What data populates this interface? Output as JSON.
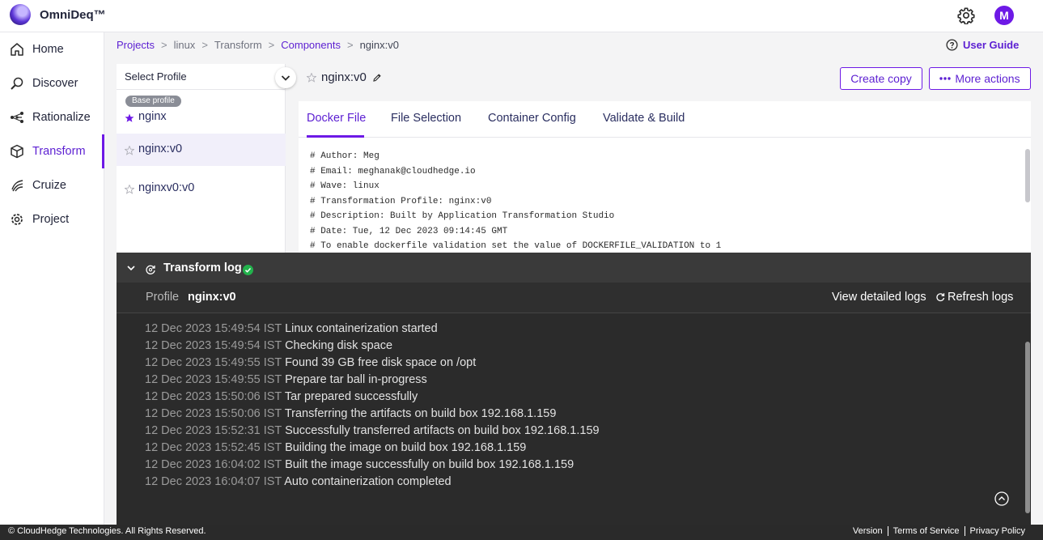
{
  "app": {
    "brand": "OmniDeq™",
    "avatar_initial": "M"
  },
  "sidebar": {
    "items": [
      {
        "label": "Home",
        "icon": "home-icon"
      },
      {
        "label": "Discover",
        "icon": "discover-icon"
      },
      {
        "label": "Rationalize",
        "icon": "rationalize-icon"
      },
      {
        "label": "Transform",
        "icon": "transform-icon",
        "active": true
      },
      {
        "label": "Cruize",
        "icon": "cruize-icon"
      },
      {
        "label": "Project",
        "icon": "project-gear-icon"
      }
    ]
  },
  "breadcrumb": {
    "projects": "Projects",
    "linux": "linux",
    "transform": "Transform",
    "components": "Components",
    "current": "nginx:v0",
    "separator": ">"
  },
  "user_guide": "User Guide",
  "profiles": {
    "select_placeholder": "Select Profile",
    "base_badge": "Base profile",
    "items": [
      {
        "name": "nginx",
        "starred": true
      },
      {
        "name": "nginx:v0",
        "starred": false,
        "selected": true
      },
      {
        "name": "nginxv0:v0",
        "starred": false
      }
    ]
  },
  "component": {
    "title": "nginx:v0",
    "create_copy": "Create copy",
    "more_actions": "More actions"
  },
  "tabs": [
    "Docker File",
    "File Selection",
    "Container Config",
    "Validate & Build"
  ],
  "dockerfile_lines": [
    "# Author: Meg",
    "# Email: meghanak@cloudhedge.io",
    "# Wave: linux",
    "# Transformation Profile: nginx:v0",
    "# Description: Built by Application Transformation Studio",
    "# Date: Tue, 12 Dec 2023 09:14:45 GMT",
    "# To enable dockerfile validation set the value of DOCKERFILE_VALIDATION to 1"
  ],
  "transform_log": {
    "title": "Transform log",
    "profile_label": "Profile",
    "profile_value": "nginx:v0",
    "view_detailed": "View detailed logs",
    "refresh": "Refresh logs",
    "lines": [
      {
        "ts": "12 Dec 2023 15:49:54 IST",
        "msg": "Linux containerization started"
      },
      {
        "ts": "12 Dec 2023 15:49:54 IST",
        "msg": "Checking disk space"
      },
      {
        "ts": "12 Dec 2023 15:49:55 IST",
        "msg": "Found 39 GB free disk space on /opt"
      },
      {
        "ts": "12 Dec 2023 15:49:55 IST",
        "msg": "Prepare tar ball in-progress"
      },
      {
        "ts": "12 Dec 2023 15:50:06 IST",
        "msg": "Tar prepared successfully"
      },
      {
        "ts": "12 Dec 2023 15:50:06 IST",
        "msg": "Transferring the artifacts on build box 192.168.1.159"
      },
      {
        "ts": "12 Dec 2023 15:52:31 IST",
        "msg": "Successfully transferred artifacts on build box 192.168.1.159"
      },
      {
        "ts": "12 Dec 2023 15:52:45 IST",
        "msg": "Building the image on build box 192.168.1.159"
      },
      {
        "ts": "12 Dec 2023 16:04:02 IST",
        "msg": "Built the image successfully on build box 192.168.1.159"
      },
      {
        "ts": "12 Dec 2023 16:04:07 IST",
        "msg": "Auto containerization completed"
      }
    ]
  },
  "footer": {
    "copyright": "© CloudHedge Technologies. All Rights Reserved.",
    "links": [
      "Version",
      "Terms of Service",
      "Privacy Policy"
    ]
  },
  "colors": {
    "accent": "#6d19e6",
    "link": "#5c1fd2",
    "success": "#22b24c",
    "log_bg": "#2b2b2b"
  }
}
